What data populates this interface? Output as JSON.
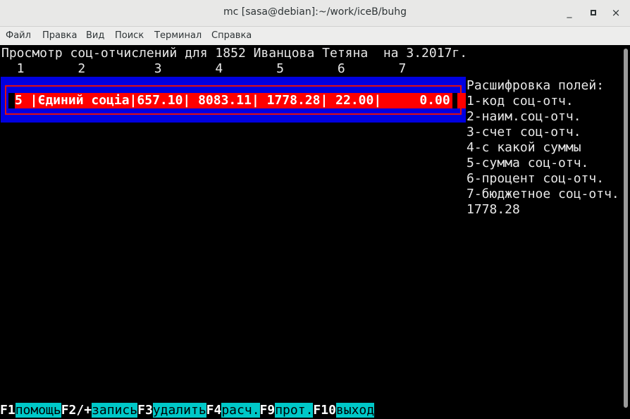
{
  "window": {
    "title": "mc [sasa@debian]:~/work/iceB/buhg",
    "minimize_glyph": "_",
    "close_glyph": "×"
  },
  "menu": {
    "items": [
      "Файл",
      "Правка",
      "Вид",
      "Поиск",
      "Терминал",
      "Справка"
    ]
  },
  "terminal": {
    "header": "Просмотр соц-отчислений для 1852 Иванцова Тетяна  на 3.2017г.",
    "column_numbers": "  1       2         3       4       5       6       7",
    "row": {
      "text": "5 |Єдиний соціа|657.10| 8083.11| 1778.28| 22.00|     0.00",
      "code": "5",
      "name": "Єдиний соціа",
      "account": "657.10",
      "base_sum": "8083.11",
      "sum": "1778.28",
      "percent": "22.00",
      "budget": "0.00"
    },
    "legend": {
      "title": "Расшифровка полей:",
      "items": [
        "1-код соц-отч.",
        "2-наим.соц-отч.",
        "3-счет соц-отч.",
        "4-с какой суммы",
        "5-сумма соц-отч.",
        "6-процент соц-отч.",
        "7-бюджетное соц-отч."
      ],
      "total": "1778.28"
    },
    "fkeys": [
      {
        "key": "F1",
        "label": "помощь"
      },
      {
        "key": "F2/+",
        "label": "запись"
      },
      {
        "key": "F3",
        "label": "удалить"
      },
      {
        "key": "F4",
        "label": "расч."
      },
      {
        "key": "F9",
        "label": "прот."
      },
      {
        "key": "F10",
        "label": "выход"
      }
    ]
  },
  "colors": {
    "highlight_row": "#ff0000",
    "frame": "#0000e0",
    "fkey_label_bg": "#00c8c8"
  }
}
